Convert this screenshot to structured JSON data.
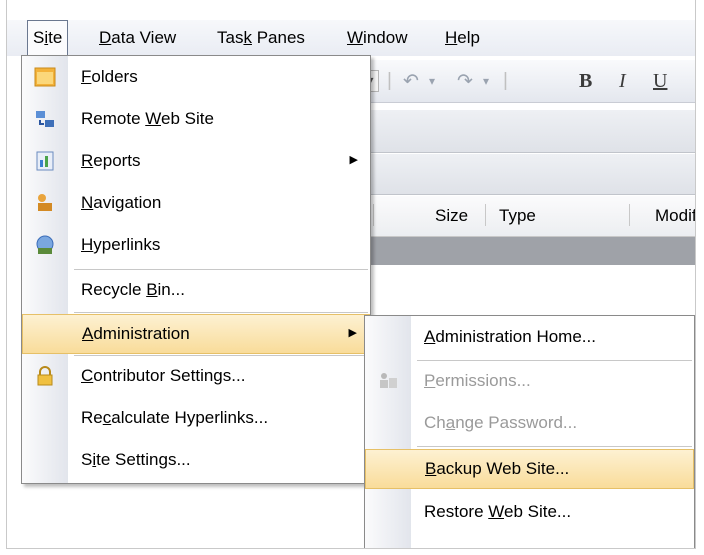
{
  "menubar": {
    "items": [
      {
        "label": "Site",
        "ul": 1
      },
      {
        "label": "Data View",
        "ul": 0
      },
      {
        "label": "Task Panes",
        "ul": 3
      },
      {
        "label": "Window",
        "ul": 0
      },
      {
        "label": "Help",
        "ul": 0
      }
    ]
  },
  "toolbar": {
    "bold": "B",
    "italic": "I",
    "underline": "U"
  },
  "file_list": {
    "columns": [
      "Size",
      "Type",
      "Modifi"
    ]
  },
  "site_menu": {
    "items": [
      {
        "label": "Folders",
        "ul": 0,
        "icon": "folder-icon"
      },
      {
        "label": "Remote Web Site",
        "ul": 7,
        "icon": "remote-site-icon"
      },
      {
        "label": "Reports",
        "ul": 0,
        "icon": "reports-icon",
        "submenu": true
      },
      {
        "label": "Navigation",
        "ul": 0,
        "icon": "navigation-icon"
      },
      {
        "label": "Hyperlinks",
        "ul": 0,
        "icon": "hyperlinks-icon"
      },
      {
        "label": "Recycle Bin...",
        "ul": 8
      },
      {
        "label": "Administration",
        "ul": 0,
        "submenu": true,
        "highlighted": true
      },
      {
        "label": "Contributor Settings...",
        "ul": 0,
        "icon": "lock-icon"
      },
      {
        "label": "Recalculate Hyperlinks...",
        "ul": 2
      },
      {
        "label": "Site Settings...",
        "ul": 1
      }
    ]
  },
  "admin_menu": {
    "items": [
      {
        "label": "Administration Home...",
        "ul": 0
      },
      {
        "label": "Permissions...",
        "ul": 0,
        "disabled": true,
        "icon": "permissions-icon"
      },
      {
        "label": "Change Password...",
        "ul": 2,
        "disabled": true
      },
      {
        "label": "Backup Web Site...",
        "ul": 0,
        "highlighted": true
      },
      {
        "label": "Restore Web Site...",
        "ul": 8
      }
    ]
  }
}
